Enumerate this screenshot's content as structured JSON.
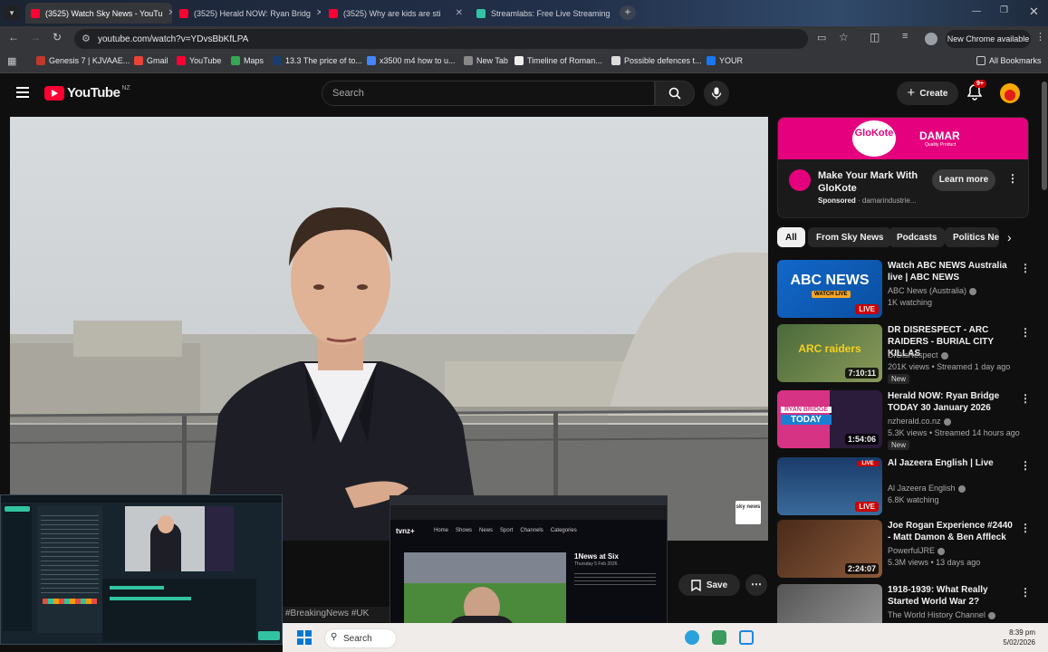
{
  "browser": {
    "tabs": [
      {
        "label": "(3525) Watch Sky News - YouTu",
        "active": true,
        "color": "#ff0033"
      },
      {
        "label": "(3525) Herald NOW: Ryan Bridg",
        "active": false,
        "color": "#ff0033"
      },
      {
        "label": "(3525) Why are kids are sti",
        "active": false,
        "color": "#ff0033"
      },
      {
        "label": "Streamlabs: Free Live Streaming",
        "active": false,
        "color": "#31c3a2"
      }
    ],
    "url": "youtube.com/watch?v=YDvsBbKfLPA",
    "new_chrome_label": "New Chrome available",
    "bookmarks": [
      {
        "label": "Genesis 7 | KJVAAE...",
        "color": "#c0392b"
      },
      {
        "label": "Gmail",
        "color": "#ea4335"
      },
      {
        "label": "YouTube",
        "color": "#ff0033"
      },
      {
        "label": "Maps",
        "color": "#34a853"
      },
      {
        "label": "13.3 The price of to...",
        "color": "#1a3c6e"
      },
      {
        "label": "x3500 m4 how to u...",
        "color": "#4285f4"
      },
      {
        "label": "New Tab",
        "color": "#888888"
      },
      {
        "label": "Timeline of Roman...",
        "color": "#eeeeee"
      },
      {
        "label": "Possible defences t...",
        "color": "#dddddd"
      },
      {
        "label": "YOUR",
        "color": "#1877f2"
      }
    ],
    "all_bookmarks_label": "All Bookmarks"
  },
  "youtube": {
    "logo_text": "YouTube",
    "region": "NZ",
    "search_placeholder": "Search",
    "create_label": "Create",
    "notification_count": "9+"
  },
  "video": {
    "channel_watermark": "sky news",
    "hashtags": "#BreakingNews #UK",
    "save_label": "Save"
  },
  "ad": {
    "brand_left": "GloKote",
    "brand_right": "DAMAR",
    "brand_right_sub": "Quality Product",
    "title": "Make Your Mark With GloKote",
    "sponsored": "Sponsored",
    "advertiser": "damarindustrie...",
    "cta": "Learn more"
  },
  "chips": [
    "All",
    "From Sky News",
    "Podcasts",
    "Politics Ne"
  ],
  "recommendations": [
    {
      "title": "Watch ABC NEWS Australia live | ABC NEWS",
      "channel": "ABC News (Australia)",
      "meta": "1K watching",
      "badge": "LIVE",
      "new": false,
      "thumb_text": "ABC NEWS",
      "thumb_sub": "WATCH LIVE"
    },
    {
      "title": "DR DISRESPECT - ARC RAIDERS - BURIAL CITY KILLAS",
      "channel": "DrDisRespect",
      "meta": "201K views • Streamed 1 day ago",
      "badge": "7:10:11",
      "new": true,
      "thumb_text": "ARC raiders",
      "thumb_sub": ""
    },
    {
      "title": "Herald NOW: Ryan Bridge TODAY 30 January 2026",
      "channel": "nzherald.co.nz",
      "meta": "5.3K views • Streamed 14 hours ago",
      "badge": "1:54:06",
      "new": true,
      "thumb_text": "RYAN BRIDGE",
      "thumb_sub": "TODAY"
    },
    {
      "title": "Al Jazeera English | Live",
      "channel": "Al Jazeera English",
      "meta": "6.8K watching",
      "badge": "LIVE",
      "new": false,
      "thumb_text": "LIVE",
      "thumb_sub": ""
    },
    {
      "title": "Joe Rogan Experience #2440 - Matt Damon & Ben Affleck",
      "channel": "PowerfulJRE",
      "meta": "5.3M views • 13 days ago",
      "badge": "2:24:07",
      "new": false,
      "thumb_text": "",
      "thumb_sub": ""
    },
    {
      "title": "1918-1939: What Really Started World War 2?",
      "channel": "The World History Channel",
      "meta": "",
      "badge": "",
      "new": false,
      "thumb_text": "",
      "thumb_sub": ""
    }
  ],
  "new_label": "New",
  "overlay_browser": {
    "logo": "tvnz+",
    "nav": [
      "Home",
      "Shows",
      "News",
      "Sport",
      "Channels",
      "Categories"
    ],
    "show_title": "1News at Six",
    "show_date": "Thursday 5 Feb 2026",
    "bug": "1news"
  },
  "taskbar": {
    "search_placeholder": "Search",
    "time": "8:39 pm",
    "date": "5/02/2026"
  }
}
